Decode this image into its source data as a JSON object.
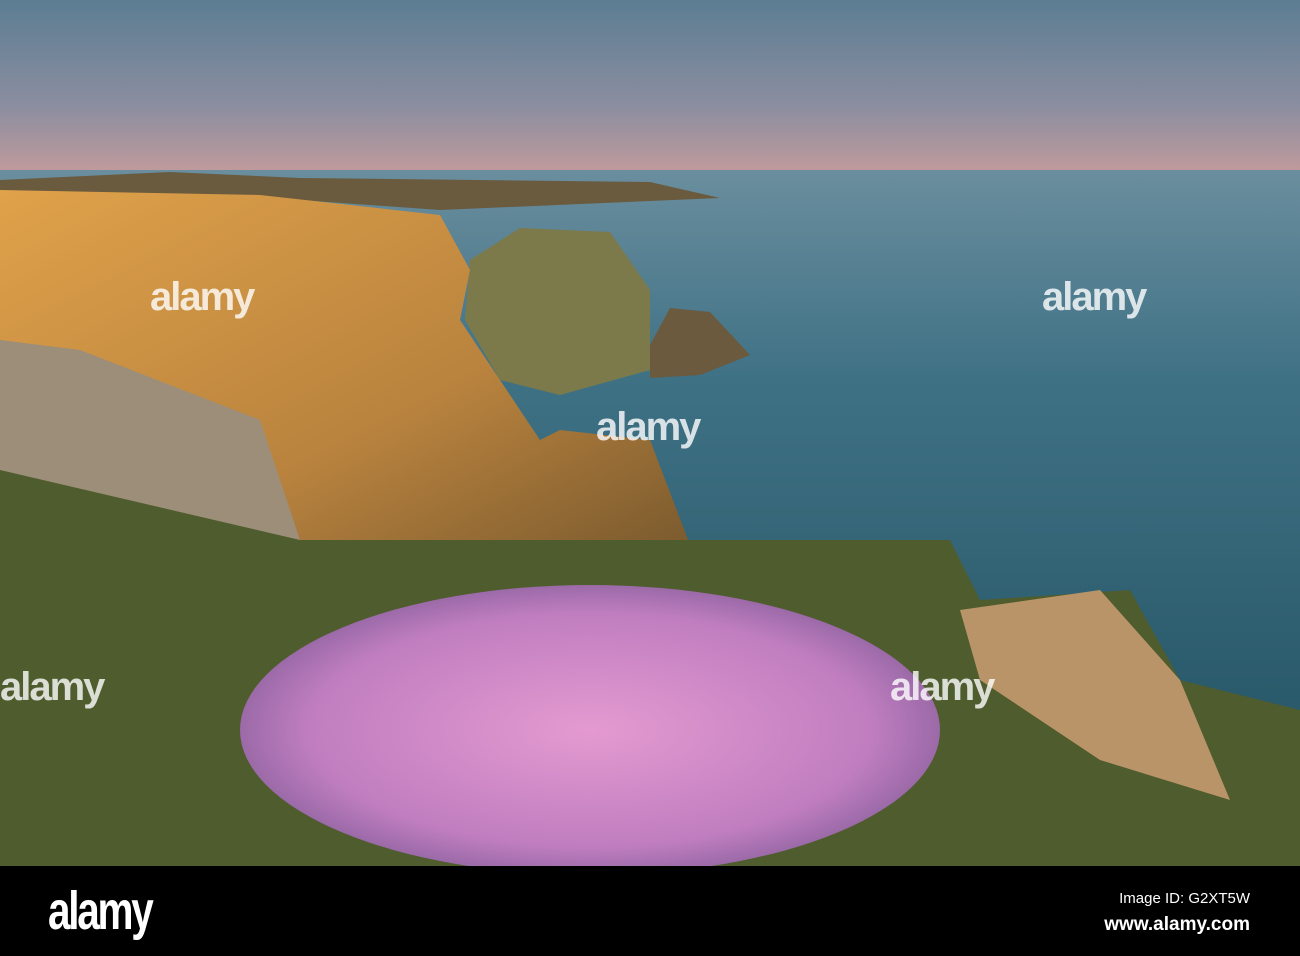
{
  "photo": {
    "subject": "sea-cliffs-with-thrift-flowers"
  },
  "watermark": {
    "text": "alamy"
  },
  "footer": {
    "logo": "alamy",
    "image_id": "Image ID: G2XT5W",
    "url": "www.alamy.com"
  },
  "colors": {
    "sky_top": "#5f7f93",
    "sky_horizon": "#c99c9c",
    "sea": "#3f6f80",
    "cliff": "#d89a45",
    "flower": "#d58bc8"
  }
}
